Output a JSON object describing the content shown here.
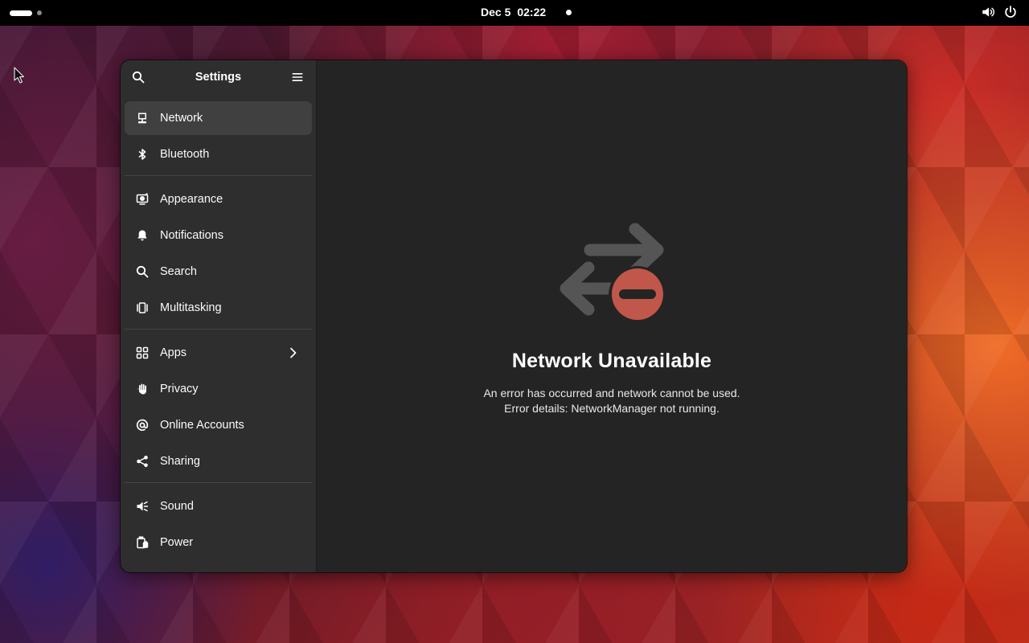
{
  "topbar": {
    "date": "Dec 5",
    "time": "02:22",
    "icons": [
      "volume-icon",
      "power-icon"
    ]
  },
  "settings": {
    "title": "Settings",
    "header_icons": [
      "search-icon",
      "hamburger-menu-icon"
    ],
    "nav_groups": [
      [
        {
          "label": "Network",
          "icon": "network-wired-icon",
          "selected": true
        },
        {
          "label": "Bluetooth",
          "icon": "bluetooth-icon"
        }
      ],
      [
        {
          "label": "Appearance",
          "icon": "appearance-icon"
        },
        {
          "label": "Notifications",
          "icon": "bell-icon"
        },
        {
          "label": "Search",
          "icon": "search-icon"
        },
        {
          "label": "Multitasking",
          "icon": "multitasking-icon"
        }
      ],
      [
        {
          "label": "Apps",
          "icon": "apps-grid-icon",
          "has_submenu": true
        },
        {
          "label": "Privacy",
          "icon": "hand-icon"
        },
        {
          "label": "Online Accounts",
          "icon": "at-sign-icon"
        },
        {
          "label": "Sharing",
          "icon": "share-icon"
        }
      ],
      [
        {
          "label": "Sound",
          "icon": "speaker-icon"
        },
        {
          "label": "Power",
          "icon": "power-battery-icon"
        }
      ]
    ]
  },
  "status": {
    "icon": "network-error-icon",
    "title": "Network Unavailable",
    "line1": "An error has occurred and network cannot be used.",
    "line2": "Error details: NetworkManager not running."
  },
  "colors": {
    "window_bg": "#242424",
    "sidebar_bg": "#2e2e2e",
    "selected_bg": "#404040",
    "error_red": "#c0574a",
    "arrow_gray": "#555555"
  }
}
